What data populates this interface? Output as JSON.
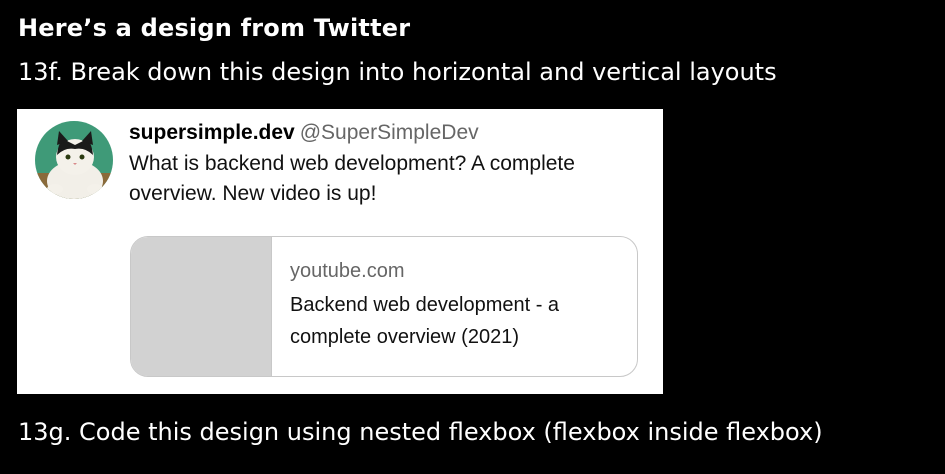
{
  "slide": {
    "title": "Here’s a design from Twitter",
    "step_13f": "13f. Break down this design into horizontal and vertical layouts",
    "step_13g": "13g. Code this design using nested flexbox (flexbox inside flexbox)"
  },
  "tweet": {
    "author_name": "supersimple.dev",
    "author_handle": "@SuperSimpleDev",
    "text": "What is backend web development? A complete overview. New video is up!",
    "avatar_icon": "cat-avatar-icon",
    "link_preview": {
      "domain": "youtube.com",
      "title": "Backend web development - a complete overview (2021)"
    }
  },
  "colors": {
    "background": "#000000",
    "card": "#ffffff",
    "handle": "#666666",
    "thumbnail": "#d2d2d2"
  }
}
